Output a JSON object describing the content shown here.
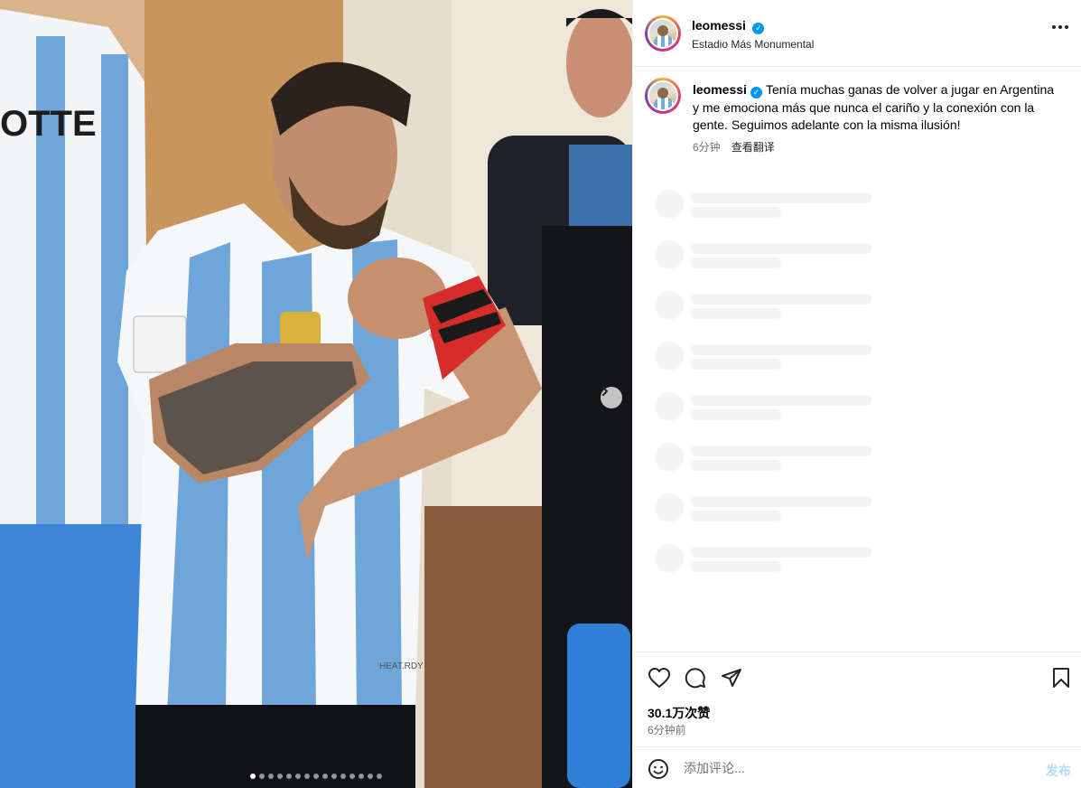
{
  "post": {
    "username": "leomessi",
    "location": "Estadio Más Monumental",
    "caption": "Tenía muchas ganas de volver a jugar en Argentina y me emociona más que nunca el cariño y la conexión con la gente. Seguimos adelante con la misma ilusión!",
    "caption_time": "6分钟",
    "translate_label": "查看翻译",
    "likes": "30.1万次赞",
    "posted_time": "6分钟前",
    "verified_icon": "verified-badge-icon"
  },
  "media": {
    "description_icons": [
      "chevron-right-icon"
    ],
    "carousel": {
      "count": 15,
      "active_index": 0
    },
    "jersey_text": "OTTE",
    "brand_text": "HEAT.RDY"
  },
  "comment": {
    "placeholder": "添加评论...",
    "post_label": "发布"
  },
  "colors": {
    "accent_blue": "#0095f6",
    "post_disabled": "#b3dbff",
    "secondary_text": "#737373"
  }
}
